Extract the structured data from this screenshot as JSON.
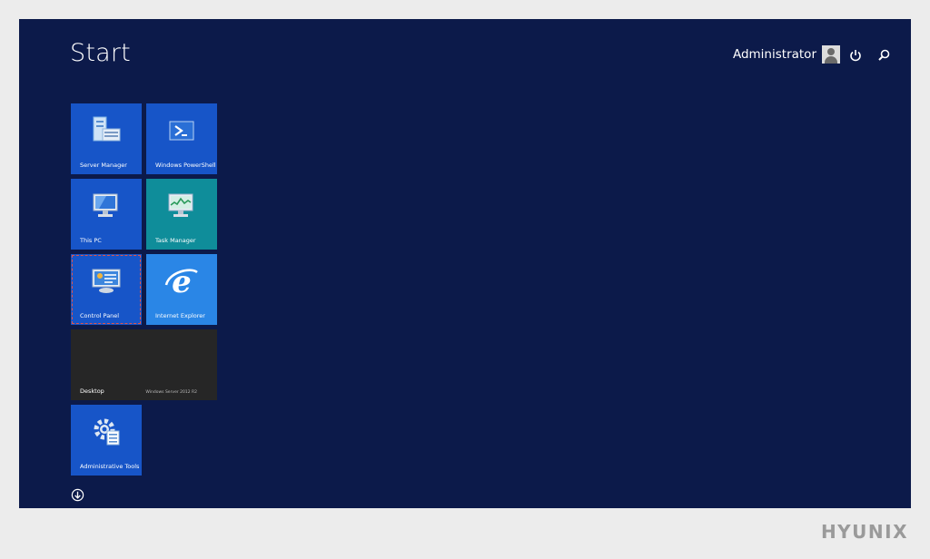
{
  "start": {
    "title": "Start"
  },
  "user": {
    "name": "Administrator"
  },
  "icons": {
    "power": "power-icon",
    "search": "search-icon",
    "apps": "arrow-down-circle-icon"
  },
  "tiles": {
    "server_manager": "Server Manager",
    "powershell": "Windows PowerShell",
    "this_pc": "This PC",
    "task_manager": "Task Manager",
    "control_panel": "Control Panel",
    "internet_explorer": "Internet Explorer",
    "desktop": "Desktop",
    "desktop_brand": "Windows Server 2012 R2",
    "administrative_tools": "Administrative Tools"
  },
  "watermark": {
    "text": "HYUNIX"
  },
  "colors": {
    "start_background": "#0c1a4a",
    "tile_blue": "#1755c8",
    "tile_teal": "#0f8d9a",
    "tile_light_blue": "#2a86e6",
    "tile_dark": "#262626",
    "selection_outline": "#e0534a"
  }
}
